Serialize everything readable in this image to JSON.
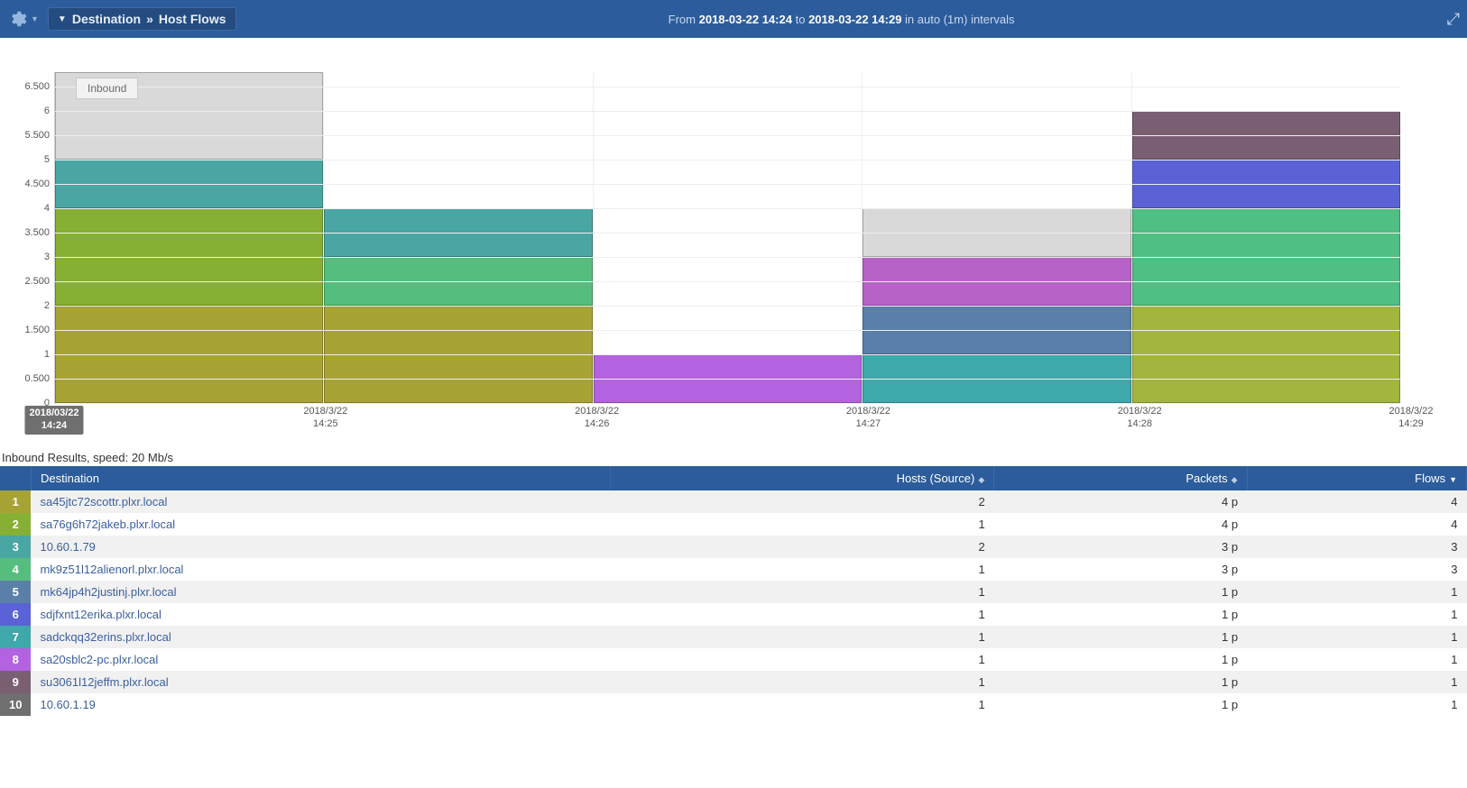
{
  "topbar": {
    "breadcrumb_prefix": "Destination",
    "breadcrumb_sep": "»",
    "breadcrumb_page": "Host Flows",
    "time_from_label": "From",
    "time_from": "2018-03-22 14:24",
    "time_to_label": "to",
    "time_to": "2018-03-22 14:29",
    "time_in": "in",
    "time_interval": "auto (1m)",
    "time_suffix": "intervals"
  },
  "chart_data": {
    "type": "bar",
    "stacked": true,
    "legend": [
      "Inbound"
    ],
    "ylabel": "",
    "ylim": [
      0,
      6.8
    ],
    "yticks": [
      0,
      0.5,
      1,
      1.5,
      2,
      2.5,
      3,
      3.5,
      4,
      4.5,
      5,
      5.5,
      6,
      6.5
    ],
    "xticks": [
      {
        "line1": "2018/03/22",
        "line2": "14:24",
        "selected": true
      },
      {
        "line1": "2018/3/22",
        "line2": "14:25"
      },
      {
        "line1": "2018/3/22",
        "line2": "14:26"
      },
      {
        "line1": "2018/3/22",
        "line2": "14:27"
      },
      {
        "line1": "2018/3/22",
        "line2": "14:28"
      },
      {
        "line1": "2018/3/22",
        "line2": "14:29"
      }
    ],
    "columns": [
      {
        "x": "14:24",
        "segments": [
          {
            "height": 2,
            "color": "#a7a335"
          },
          {
            "height": 2,
            "color": "#86b034"
          },
          {
            "height": 1,
            "color": "#4aa6a3"
          },
          {
            "height": 1.8,
            "color": "#d9d9d9"
          }
        ]
      },
      {
        "x": "14:25",
        "segments": [
          {
            "height": 2,
            "color": "#a7a335"
          },
          {
            "height": 1,
            "color": "#55be7e"
          },
          {
            "height": 1,
            "color": "#4aa6a3"
          }
        ]
      },
      {
        "x": "14:26",
        "segments": [
          {
            "height": 1,
            "color": "#b362e0"
          }
        ]
      },
      {
        "x": "14:27",
        "segments": [
          {
            "height": 1,
            "color": "#3ea8ab"
          },
          {
            "height": 1,
            "color": "#5a7fa8"
          },
          {
            "height": 1,
            "color": "#b762c7"
          },
          {
            "height": 1,
            "color": "#d9d9d9"
          }
        ]
      },
      {
        "x": "14:28",
        "segments": [
          {
            "height": 2,
            "color": "#a4b53e"
          },
          {
            "height": 2,
            "color": "#4fbf83"
          },
          {
            "height": 1,
            "color": "#5a62d6"
          },
          {
            "height": 1,
            "color": "#7a5f72"
          }
        ]
      }
    ]
  },
  "results": {
    "title": "Inbound Results, speed: 20 Mb/s",
    "columns": {
      "dest": "Destination",
      "hosts": "Hosts (Source)",
      "packets": "Packets",
      "flows": "Flows"
    },
    "rows": [
      {
        "idx": "1",
        "color": "#a7a335",
        "dest": "sa45jtc72scottr.plxr.local",
        "hosts": "2",
        "packets": "4 p",
        "flows": "4"
      },
      {
        "idx": "2",
        "color": "#86b034",
        "dest": "sa76g6h72jakeb.plxr.local",
        "hosts": "1",
        "packets": "4 p",
        "flows": "4"
      },
      {
        "idx": "3",
        "color": "#4aa6a3",
        "dest": "10.60.1.79",
        "hosts": "2",
        "packets": "3 p",
        "flows": "3"
      },
      {
        "idx": "4",
        "color": "#55be7e",
        "dest": "mk9z51l12alienorl.plxr.local",
        "hosts": "1",
        "packets": "3 p",
        "flows": "3"
      },
      {
        "idx": "5",
        "color": "#5a7fa8",
        "dest": "mk64jp4h2justinj.plxr.local",
        "hosts": "1",
        "packets": "1 p",
        "flows": "1"
      },
      {
        "idx": "6",
        "color": "#5a62d6",
        "dest": "sdjfxnt12erika.plxr.local",
        "hosts": "1",
        "packets": "1 p",
        "flows": "1"
      },
      {
        "idx": "7",
        "color": "#3ea8ab",
        "dest": "sadckqq32erins.plxr.local",
        "hosts": "1",
        "packets": "1 p",
        "flows": "1"
      },
      {
        "idx": "8",
        "color": "#b362e0",
        "dest": "sa20sblc2-pc.plxr.local",
        "hosts": "1",
        "packets": "1 p",
        "flows": "1"
      },
      {
        "idx": "9",
        "color": "#7a5f72",
        "dest": "su3061l12jeffm.plxr.local",
        "hosts": "1",
        "packets": "1 p",
        "flows": "1"
      },
      {
        "idx": "10",
        "color": "#6f6f6f",
        "dest": "10.60.1.19",
        "hosts": "1",
        "packets": "1 p",
        "flows": "1"
      }
    ]
  }
}
